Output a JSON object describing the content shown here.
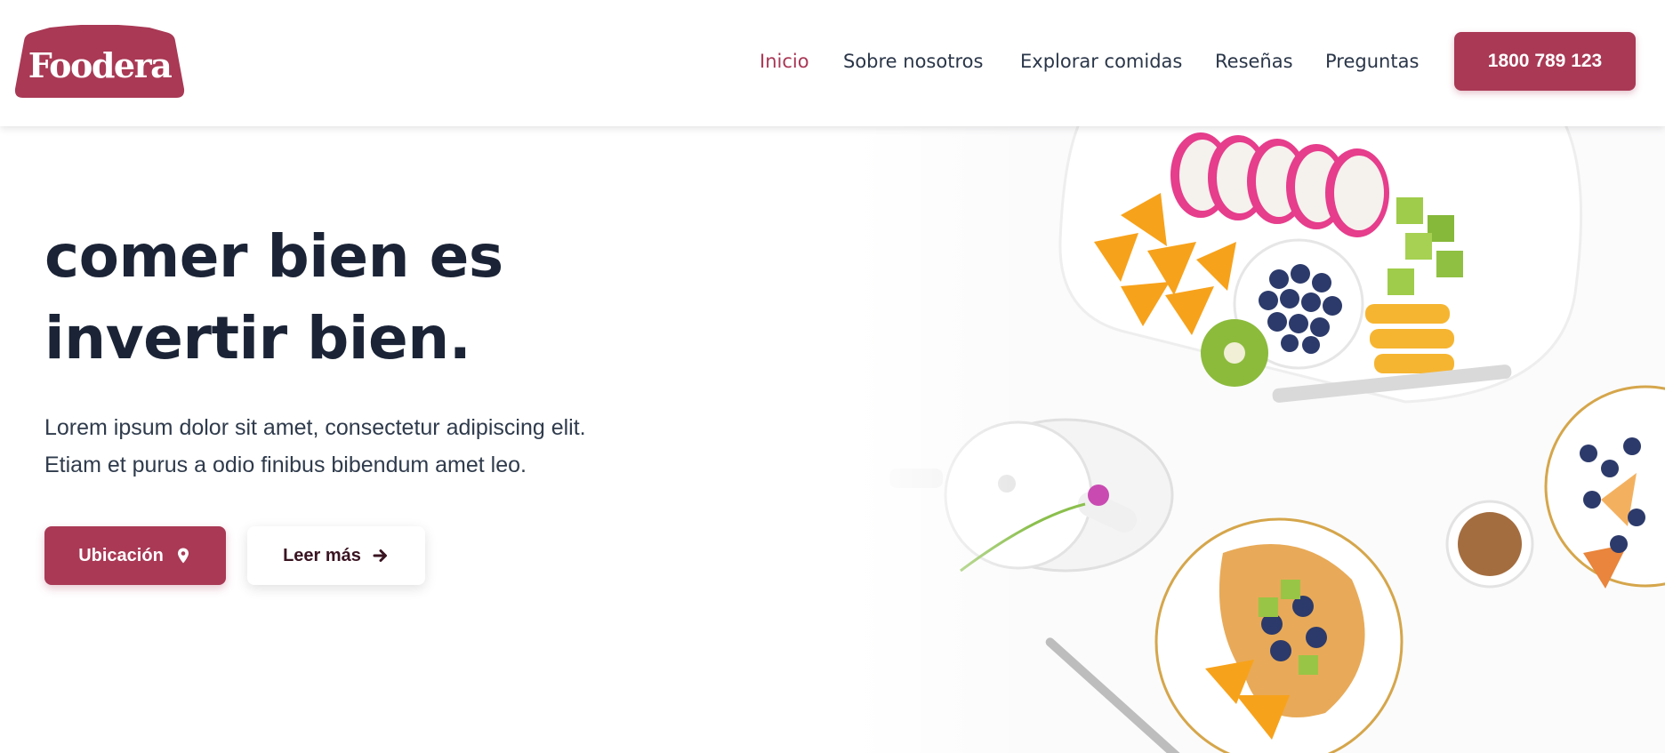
{
  "brand": {
    "name": "Foodera",
    "color": "#a93955"
  },
  "nav": {
    "items": [
      {
        "label": "Inicio",
        "active": true
      },
      {
        "label": "Sobre nosotros",
        "active": false
      },
      {
        "label": "Explorar comidas",
        "active": false
      },
      {
        "label": "Reseñas",
        "active": false
      },
      {
        "label": "Preguntas",
        "active": false
      }
    ],
    "phone": "1800 789 123"
  },
  "hero": {
    "headline_line1": "comer bien es",
    "headline_line2": "invertir bien.",
    "text_line1": "Lorem ipsum dolor sit amet, consectetur adipiscing elit.",
    "text_line2": "Etiam et purus a odio finibus bibendum amet leo.",
    "primary_button": {
      "label": "Ubicación",
      "icon": "map-pin-icon"
    },
    "secondary_button": {
      "label": "Leer más",
      "icon": "arrow-right-icon"
    }
  },
  "image": {
    "subject": "food-spread-photo"
  },
  "colors": {
    "accent": "#a93955",
    "text_dark": "#1b2436",
    "nav_text": "#2a3649",
    "active_nav": "#a93755"
  }
}
